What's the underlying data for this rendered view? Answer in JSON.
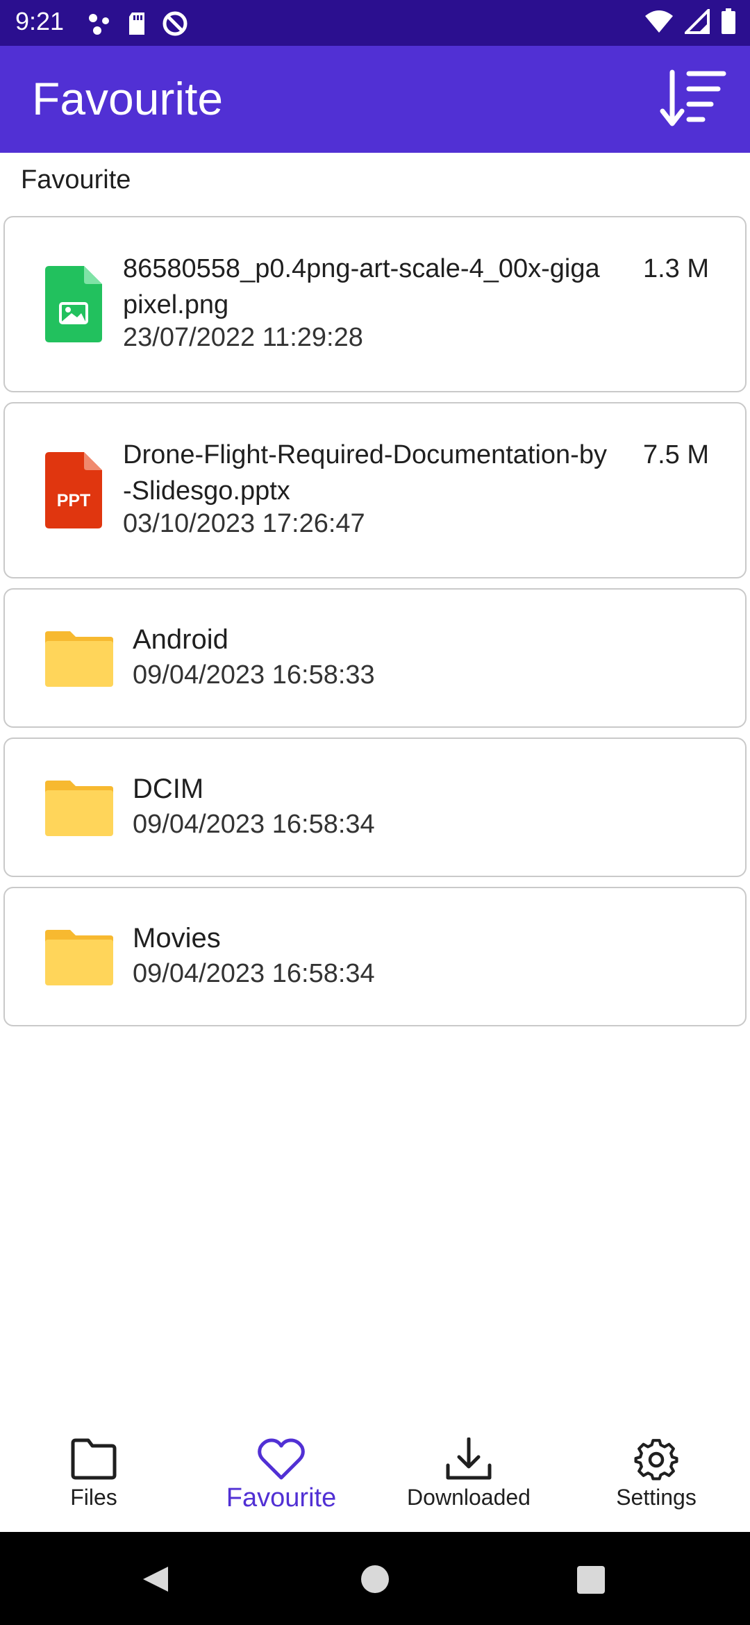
{
  "status_bar": {
    "time": "9:21",
    "left_icons": [
      "dots-icon",
      "sd-card-icon",
      "sync-off-icon"
    ],
    "right_icons": [
      "wifi-icon",
      "signal-icon",
      "battery-icon"
    ]
  },
  "app_bar": {
    "title": "Favourite",
    "sort_icon": "sort-icon"
  },
  "section": {
    "label": "Favourite"
  },
  "items": [
    {
      "type": "image-file",
      "name": "86580558_p0.4png-art-scale-4_00x-gigapixel.png",
      "date": "23/07/2022 11:29:28",
      "size": "1.3 M",
      "icon_color": "#22c15e"
    },
    {
      "type": "ppt-file",
      "name": "Drone-Flight-Required-Documentation-by-Slidesgo.pptx",
      "date": "03/10/2023 17:26:47",
      "size": "7.5 M",
      "icon_color": "#e0360f",
      "icon_text": "PPT"
    },
    {
      "type": "folder",
      "name": "Android",
      "date": "09/04/2023 16:58:33"
    },
    {
      "type": "folder",
      "name": "DCIM",
      "date": "09/04/2023 16:58:34"
    },
    {
      "type": "folder",
      "name": "Movies",
      "date": "09/04/2023 16:58:34"
    }
  ],
  "bottom_nav": [
    {
      "label": "Files",
      "icon": "folder-icon",
      "active": false
    },
    {
      "label": "Favourite",
      "icon": "heart-icon",
      "active": true
    },
    {
      "label": "Downloaded",
      "icon": "download-icon",
      "active": false
    },
    {
      "label": "Settings",
      "icon": "gear-icon",
      "active": false
    }
  ],
  "colors": {
    "status_bar": "#2b0f8f",
    "app_bar": "#5130d4",
    "accent": "#5130d4",
    "folder": "#ffd55a"
  },
  "system_nav": [
    "back-icon",
    "home-icon",
    "recents-icon"
  ]
}
